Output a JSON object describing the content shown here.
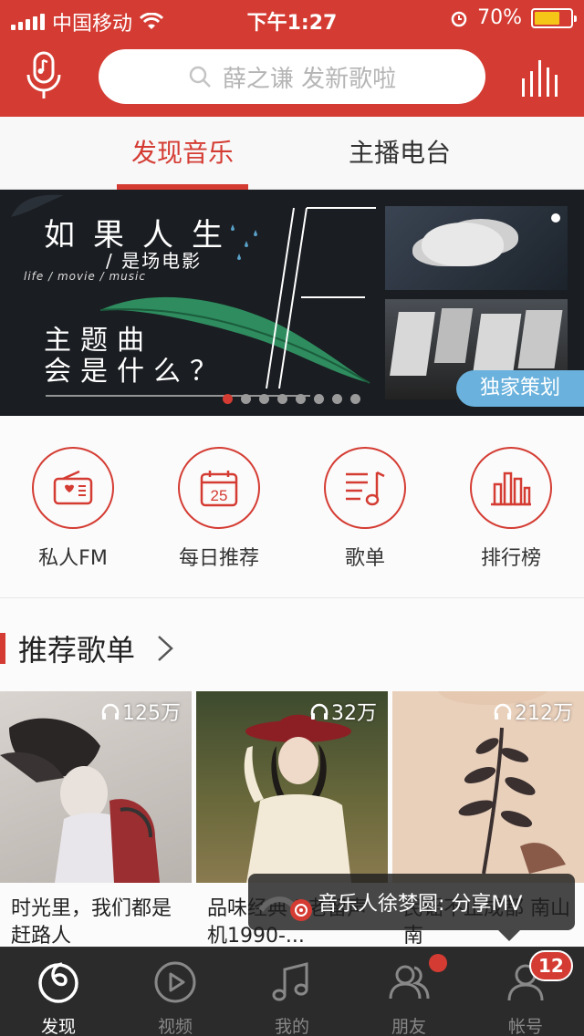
{
  "status_bar": {
    "carrier": "中国移动",
    "time": "下午1:27",
    "battery": "70%",
    "battery_level": 0.7
  },
  "header": {
    "search_placeholder": "薛之谦 发新歌啦"
  },
  "tabs": [
    {
      "label": "发现音乐",
      "active": true
    },
    {
      "label": "主播电台",
      "active": false
    }
  ],
  "banner": {
    "title": "如果人生",
    "subtitle": "/ 是场电影",
    "english": "life / movie / music",
    "question_line1": "主题曲",
    "question_line2": "会是什么？",
    "badge": "独家策划",
    "page_count": 8,
    "active_page": 0
  },
  "quick_links": [
    {
      "label": "私人FM",
      "icon": "radio-icon"
    },
    {
      "label": "每日推荐",
      "icon": "calendar-icon",
      "day": "25"
    },
    {
      "label": "歌单",
      "icon": "playlist-icon"
    },
    {
      "label": "排行榜",
      "icon": "chart-icon"
    }
  ],
  "recommended": {
    "title": "推荐歌单",
    "playlists": [
      {
        "plays": "125万",
        "title": "时光里，我们都是赶路人"
      },
      {
        "plays": "32万",
        "title": "品味经典 | 老留声机1990-..."
      },
      {
        "plays": "212万",
        "title": "民谣不止成都 南山南"
      }
    ]
  },
  "toast": {
    "text": "音乐人徐梦圆: 分享MV"
  },
  "tab_bar": [
    {
      "label": "发现",
      "icon": "netease-logo-icon",
      "active": true
    },
    {
      "label": "视频",
      "icon": "video-icon",
      "active": false
    },
    {
      "label": "我的",
      "icon": "music-note-icon",
      "active": false
    },
    {
      "label": "朋友",
      "icon": "friends-icon",
      "active": false
    },
    {
      "label": "帐号",
      "icon": "account-icon",
      "active": false
    }
  ],
  "notification_count": "12",
  "colors": {
    "brand_red": "#d43c33",
    "badge_blue": "#6ab2dd",
    "tabbar_bg": "#2b2b2b"
  }
}
